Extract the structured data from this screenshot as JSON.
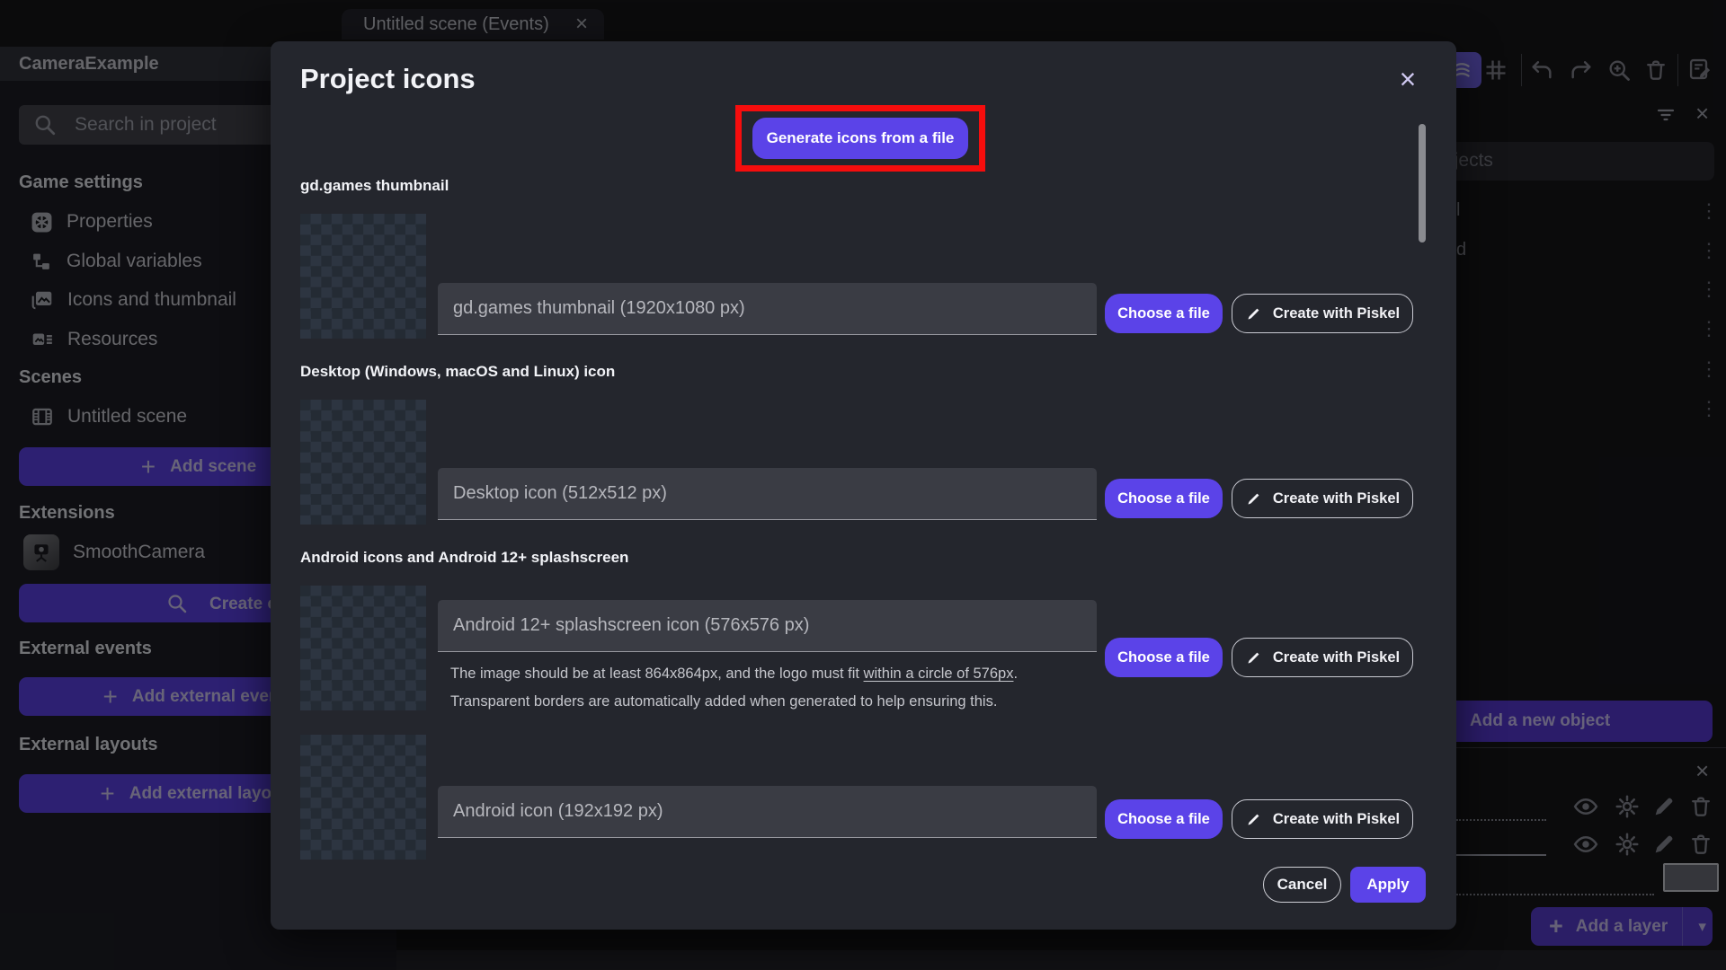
{
  "colors": {
    "primary": "#5b43e8",
    "annotation_red": "#f60d0d",
    "modal_bg": "#24262d"
  },
  "glyphs": {
    "close": "×",
    "plus": "+",
    "kebab": "⋮",
    "caret_down": "▾"
  },
  "tab": {
    "label": "Untitled scene (Events)"
  },
  "toolbar": {
    "icon_names": [
      "layers",
      "grid",
      "undo",
      "redo",
      "zoom-in",
      "trash",
      "edit-scene"
    ]
  },
  "sidebar": {
    "project_title": "CameraExample",
    "search_placeholder": "Search in project",
    "sections": {
      "game_settings": {
        "heading": "Game settings",
        "items": [
          "Properties",
          "Global variables",
          "Icons and thumbnail",
          "Resources"
        ]
      },
      "scenes": {
        "heading": "Scenes",
        "items": [
          "Untitled scene"
        ],
        "add_button": "Add scene"
      },
      "extensions": {
        "heading": "Extensions",
        "items": [
          "SmoothCamera"
        ],
        "search_button": "Create or search for new extensions"
      },
      "external_events": {
        "heading": "External events",
        "add_button": "Add external events"
      },
      "external_layouts": {
        "heading": "External layouts",
        "add_button": "Add external layouts"
      }
    }
  },
  "modal": {
    "title": "Project icons",
    "generate_button": "Generate icons from a file",
    "choose_file_button": "Choose a file",
    "piskel_button": "Create with Piskel",
    "sections": {
      "gdgames": {
        "heading": "gd.games thumbnail",
        "field_value": "gd.games thumbnail (1920x1080 px)"
      },
      "desktop": {
        "heading": "Desktop (Windows, macOS and Linux) icon",
        "field_value": "Desktop icon (512x512 px)"
      },
      "android": {
        "heading": "Android icons and Android 12+ splashscreen",
        "splash_field_value": "Android 12+ splashscreen icon (576x576 px)",
        "helper_pre": "The image should be at least 864x864px, and the logo must fit ",
        "helper_underlined": "within a circle of 576px",
        "helper_post": ".",
        "helper_line2": "Transparent borders are automatically added when generated to help ensuring this.",
        "icon_field_value": "Android icon (192x192 px)"
      }
    },
    "cancel_button": "Cancel",
    "apply_button": "Apply"
  },
  "objects_panel": {
    "search_placeholder": "Search objects",
    "row_fragments": [
      "l",
      "d"
    ],
    "add_button": "Add a new object"
  },
  "layers_panel": {
    "add_button": "Add a layer"
  }
}
